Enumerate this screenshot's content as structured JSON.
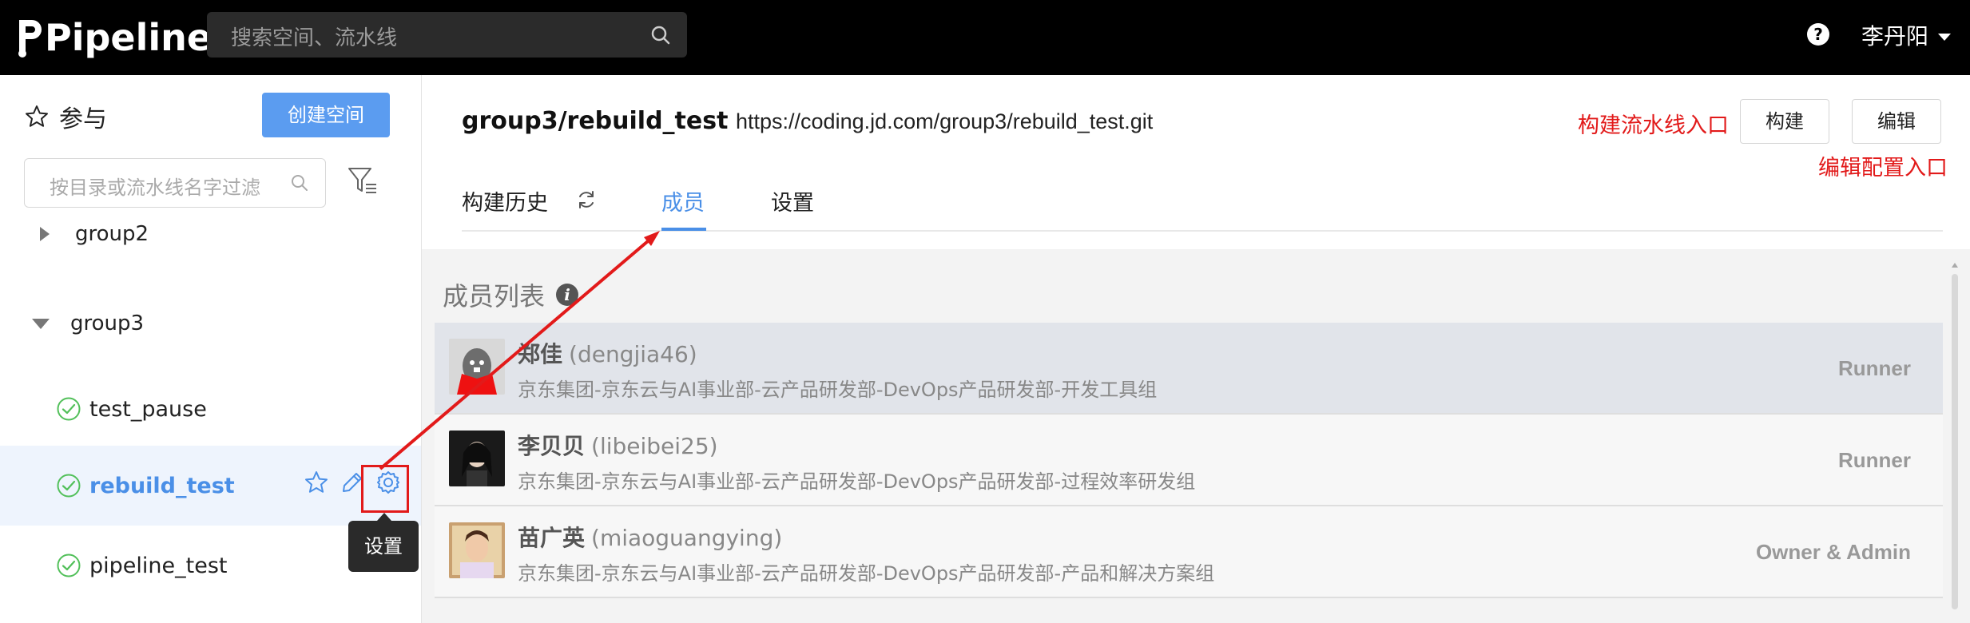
{
  "topbar": {
    "logo": "Pipeline",
    "search_placeholder": "搜索空间、流水线",
    "help": "?",
    "user": "李丹阳"
  },
  "sidebar": {
    "header": "参与",
    "create_button": "创建空间",
    "filter_placeholder": "按目录或流水线名字过滤",
    "groups": [
      {
        "name": "group2",
        "expanded": false
      },
      {
        "name": "group3",
        "expanded": true
      }
    ],
    "pipelines": [
      {
        "name": "test_pause",
        "active": false
      },
      {
        "name": "rebuild_test",
        "active": true
      },
      {
        "name": "pipeline_test",
        "active": false
      }
    ],
    "tooltip": "设置"
  },
  "main": {
    "title": "group3/rebuild_test",
    "url": "https://coding.jd.com/group3/rebuild_test.git",
    "annotation_build": "构建流水线入口",
    "annotation_edit": "编辑配置入口",
    "build_button": "构建",
    "edit_button": "编辑",
    "tabs": [
      {
        "label": "构建历史"
      },
      {
        "label": "成员",
        "active": true
      },
      {
        "label": "设置"
      }
    ],
    "members_title": "成员列表",
    "members": [
      {
        "name": "郑佳",
        "account": "(dengjia46)",
        "dept": "京东集团-京东云与AI事业部-云产品研发部-DevOps产品研发部-开发工具组",
        "role": "Runner"
      },
      {
        "name": "李贝贝",
        "account": "(libeibei25)",
        "dept": "京东集团-京东云与AI事业部-云产品研发部-DevOps产品研发部-过程效率研发组",
        "role": "Runner"
      },
      {
        "name": "苗广英",
        "account": "(miaoguangying)",
        "dept": "京东集团-京东云与AI事业部-云产品研发部-DevOps产品研发部-产品和解决方案组",
        "role": "Owner & Admin"
      }
    ]
  },
  "colors": {
    "accent": "#4a8fe7",
    "annotation": "#e21a1a",
    "topbar": "#000000"
  }
}
